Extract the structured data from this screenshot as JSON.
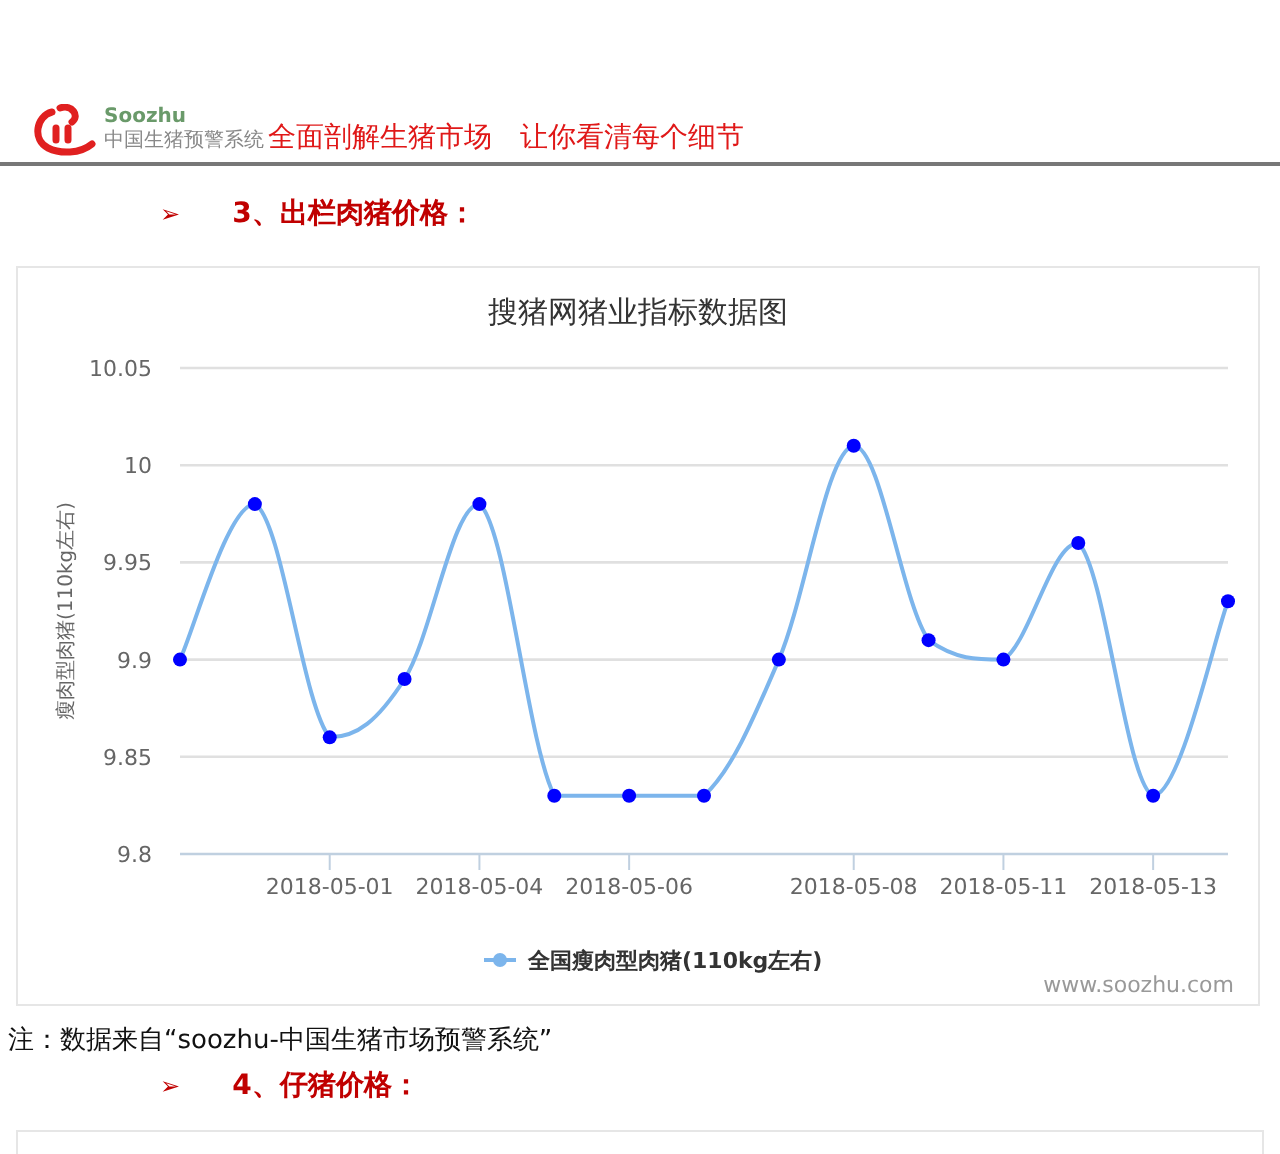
{
  "header": {
    "logo_name": "Soozhu",
    "logo_subtitle": "中国生猪预警系统",
    "slogan": "全面剖解生猪市场　让你看清每个细节"
  },
  "section_1": {
    "bullet": "➢",
    "heading": "3、出栏肉猪价格："
  },
  "chart": {
    "credit": "www.soozhu.com",
    "chart_data": {
      "type": "line",
      "title": "搜猪网猪业指标数据图",
      "ylabel": "瘦肉型肉猪(110kg左右)",
      "categories": [
        null,
        null,
        "2018-05-01",
        null,
        "2018-05-04",
        null,
        "2018-05-06",
        null,
        null,
        "2018-05-08",
        null,
        "2018-05-11",
        null,
        "2018-05-13",
        null
      ],
      "series": [
        {
          "name": "全国瘦肉型肉猪(110kg左右)",
          "color": "#7cb5ec",
          "marker": true,
          "values": [
            9.9,
            9.98,
            9.86,
            9.89,
            9.98,
            9.83,
            9.83,
            9.83,
            9.9,
            10.01,
            9.91,
            9.9,
            9.96,
            9.83,
            9.93
          ]
        }
      ],
      "grid": true,
      "ylim": [
        9.8,
        10.05
      ],
      "yticks": [
        9.8,
        9.85,
        9.9,
        9.95,
        10,
        10.05
      ]
    }
  },
  "note": "注：数据来自“soozhu-中国生猪市场预警系统”",
  "section_2": {
    "bullet": "➢",
    "heading": "4、仔猪价格："
  }
}
